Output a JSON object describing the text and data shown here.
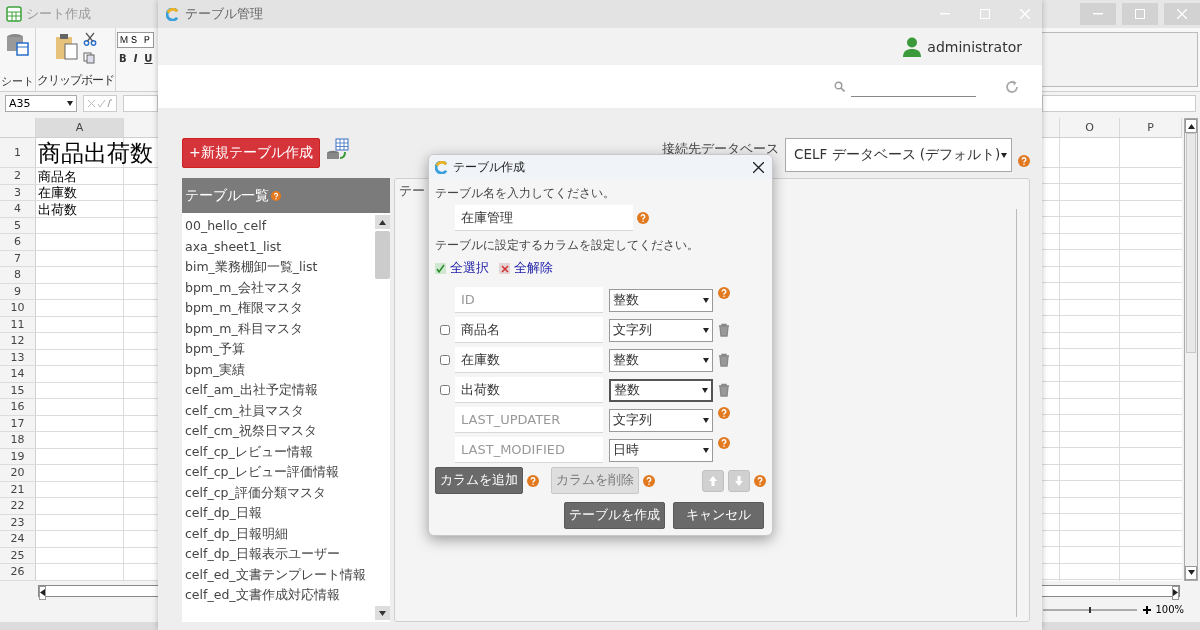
{
  "sheet_window": {
    "title": "シート作成",
    "ribbon": {
      "groups": [
        {
          "label": "シート"
        },
        {
          "label": "クリップボード"
        }
      ],
      "font_name": "ＭＳ Ｐ",
      "format_buttons": [
        "B",
        "I",
        "U"
      ]
    },
    "name_box": "A35",
    "columns": [
      {
        "label": "A"
      },
      {
        "label": "O"
      },
      {
        "label": "P"
      }
    ],
    "rows": [
      {
        "number": "1",
        "text": "商品出荷数",
        "kind": "heading"
      },
      {
        "number": "2",
        "text": "商品名",
        "kind": "label"
      },
      {
        "number": "3",
        "text": "在庫数",
        "kind": "label"
      },
      {
        "number": "4",
        "text": "出荷数",
        "kind": "label"
      },
      {
        "number": "5"
      },
      {
        "number": "6"
      },
      {
        "number": "7"
      },
      {
        "number": "8"
      },
      {
        "number": "9"
      },
      {
        "number": "10"
      },
      {
        "number": "11"
      },
      {
        "number": "12"
      },
      {
        "number": "13"
      },
      {
        "number": "14"
      },
      {
        "number": "15"
      },
      {
        "number": "16"
      },
      {
        "number": "17"
      },
      {
        "number": "18"
      },
      {
        "number": "19"
      },
      {
        "number": "20"
      },
      {
        "number": "21"
      },
      {
        "number": "22"
      },
      {
        "number": "23"
      },
      {
        "number": "24"
      },
      {
        "number": "25"
      },
      {
        "number": "26"
      }
    ],
    "zoom_slider": {
      "level": 0.5
    },
    "zoom": "100%"
  },
  "app_window": {
    "title": "テーブル管理",
    "user": "administrator",
    "new_table_button": "+新規テーブル作成",
    "database": {
      "label": "接続先データベース",
      "value": "CELF データベース (デフォルト)"
    },
    "table_list": {
      "title": "テーブル一覧",
      "items": [
        {
          "label": "00_hello_celf",
          "selected": false
        },
        {
          "label": "axa_sheet1_list",
          "selected": false
        },
        {
          "label": "bim_業務棚卸一覧_list",
          "selected": false
        },
        {
          "label": "bpm_m_会社マスタ",
          "selected": false
        },
        {
          "label": "bpm_m_権限マスタ",
          "selected": false
        },
        {
          "label": "bpm_m_科目マスタ",
          "selected": false
        },
        {
          "label": "bpm_予算",
          "selected": false
        },
        {
          "label": "bpm_実績",
          "selected": false
        },
        {
          "label": "celf_am_出社予定情報",
          "selected": false
        },
        {
          "label": "celf_cm_社員マスタ",
          "selected": false
        },
        {
          "label": "celf_cm_祝祭日マスタ",
          "selected": false
        },
        {
          "label": "celf_cp_レビュー情報",
          "selected": false
        },
        {
          "label": "celf_cp_レビュー評価情報",
          "selected": false
        },
        {
          "label": "celf_cp_評価分類マスタ",
          "selected": false
        },
        {
          "label": "celf_dp_日報",
          "selected": false
        },
        {
          "label": "celf_dp_日報明細",
          "selected": false
        },
        {
          "label": "celf_dp_日報表示ユーザー",
          "selected": false
        },
        {
          "label": "celf_ed_文書テンプレート情報",
          "selected": false
        },
        {
          "label": "celf_ed_文書作成対応情報",
          "selected": false
        }
      ]
    },
    "detail_tab": "テー"
  },
  "dialog": {
    "title": "テーブル作成",
    "name_prompt": "テーブル名を入力してください。",
    "table_name": "在庫管理",
    "column_prompt": "テーブルに設定するカラムを設定してください。",
    "select_all": "全選択",
    "deselect_all": "全解除",
    "columns": [
      {
        "name": "ID",
        "type": "整数",
        "kind": "system",
        "focused": false
      },
      {
        "name": "商品名",
        "type": "文字列",
        "kind": "user",
        "checked": false,
        "focused": false
      },
      {
        "name": "在庫数",
        "type": "整数",
        "kind": "user",
        "checked": false,
        "focused": false
      },
      {
        "name": "出荷数",
        "type": "整数",
        "kind": "user",
        "checked": false,
        "focused": true
      },
      {
        "name": "LAST_UPDATER",
        "type": "文字列",
        "kind": "system",
        "focused": false
      },
      {
        "name": "LAST_MODIFIED",
        "type": "日時",
        "kind": "system",
        "focused": false
      }
    ],
    "add_column": "カラムを追加",
    "delete_column": {
      "label": "カラムを削除",
      "disabled": true
    },
    "move_disabled": true,
    "create": "テーブルを作成",
    "cancel": "キャンセル"
  }
}
